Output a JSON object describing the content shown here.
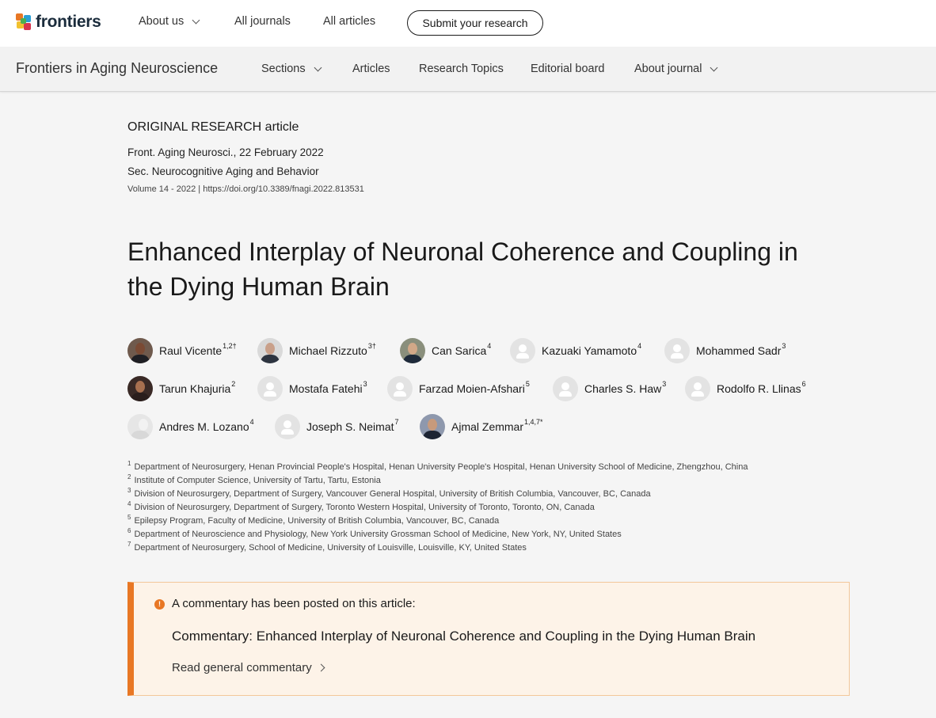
{
  "site": {
    "logo_text": "frontiers",
    "nav": {
      "about_us": "About us",
      "all_journals": "All journals",
      "all_articles": "All articles",
      "submit": "Submit your research"
    }
  },
  "journal": {
    "title": "Frontiers in Aging Neuroscience",
    "nav": {
      "sections": "Sections",
      "articles": "Articles",
      "research_topics": "Research Topics",
      "editorial_board": "Editorial board",
      "about_journal": "About journal"
    }
  },
  "article": {
    "type": "ORIGINAL RESEARCH article",
    "citation": "Front. Aging Neurosci., 22 February 2022",
    "section": "Sec. Neurocognitive Aging and Behavior",
    "volume_doi": "Volume 14 - 2022 | https://doi.org/10.3389/fnagi.2022.813531",
    "title": "Enhanced Interplay of Neuronal Coherence and Coupling in the Dying Human Brain"
  },
  "authors": [
    {
      "name": "Raul Vicente",
      "sup": "1,2†"
    },
    {
      "name": "Michael Rizzuto",
      "sup": "3†"
    },
    {
      "name": "Can Sarica",
      "sup": "4"
    },
    {
      "name": "Kazuaki Yamamoto",
      "sup": "4"
    },
    {
      "name": "Mohammed Sadr",
      "sup": "3"
    },
    {
      "name": "Tarun Khajuria",
      "sup": "2"
    },
    {
      "name": "Mostafa Fatehi",
      "sup": "3"
    },
    {
      "name": "Farzad Moien-Afshari",
      "sup": "5"
    },
    {
      "name": "Charles S. Haw",
      "sup": "3"
    },
    {
      "name": "Rodolfo R. Llinas",
      "sup": "6"
    },
    {
      "name": "Andres M. Lozano",
      "sup": "4"
    },
    {
      "name": "Joseph S. Neimat",
      "sup": "7"
    },
    {
      "name": "Ajmal Zemmar",
      "sup": "1,4,7*"
    }
  ],
  "affiliations": [
    {
      "num": "1",
      "text": "Department of Neurosurgery, Henan Provincial People's Hospital, Henan University People's Hospital, Henan University School of Medicine, Zhengzhou, China"
    },
    {
      "num": "2",
      "text": "Institute of Computer Science, University of Tartu, Tartu, Estonia"
    },
    {
      "num": "3",
      "text": "Division of Neurosurgery, Department of Surgery, Vancouver General Hospital, University of British Columbia, Vancouver, BC, Canada"
    },
    {
      "num": "4",
      "text": "Division of Neurosurgery, Department of Surgery, Toronto Western Hospital, University of Toronto, Toronto, ON, Canada"
    },
    {
      "num": "5",
      "text": "Epilepsy Program, Faculty of Medicine, University of British Columbia, Vancouver, BC, Canada"
    },
    {
      "num": "6",
      "text": "Department of Neuroscience and Physiology, New York University Grossman School of Medicine, New York, NY, United States"
    },
    {
      "num": "7",
      "text": "Department of Neurosurgery, School of Medicine, University of Louisville, Louisville, KY, United States"
    }
  ],
  "commentary": {
    "icon": "alert-icon",
    "icon_glyph": "!",
    "intro": "A commentary has been posted on this article:",
    "title": "Commentary: Enhanced Interplay of Neuronal Coherence and Coupling in the Dying Human Brain",
    "link": "Read general commentary"
  },
  "colors": {
    "accent": "#e87724",
    "commentary_bg": "#fdf3e8",
    "logo_dark": "#1b2c3c"
  }
}
